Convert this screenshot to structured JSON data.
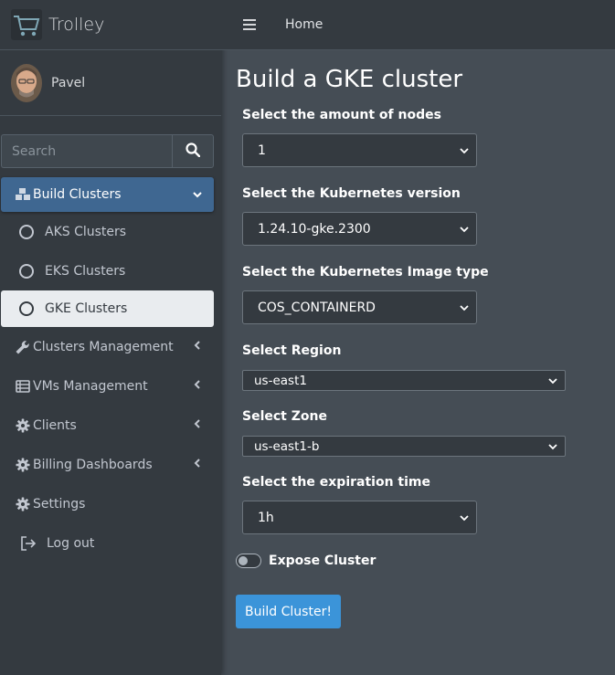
{
  "brand": {
    "name": "Trolley"
  },
  "user": {
    "name": "Pavel"
  },
  "search": {
    "placeholder": "Search"
  },
  "sidebar": {
    "build_clusters": "Build Clusters",
    "sub_items": [
      "AKS Clusters",
      "EKS Clusters",
      "GKE Clusters"
    ],
    "clusters_management": "Clusters Management",
    "vms_management": "VMs Management",
    "clients": "Clients",
    "billing_dashboards": "Billing Dashboards",
    "settings": "Settings",
    "logout": "Log out"
  },
  "topbar": {
    "home": "Home"
  },
  "main": {
    "title": "Build a GKE cluster",
    "fields": [
      {
        "label": "Select the amount of nodes",
        "value": "1"
      },
      {
        "label": "Select the Kubernetes version",
        "value": "1.24.10-gke.2300"
      },
      {
        "label": "Select the Kubernetes Image type",
        "value": "COS_CONTAINERD"
      },
      {
        "label": "Select Region",
        "value": "us-east1"
      },
      {
        "label": "Select Zone",
        "value": "us-east1-b"
      },
      {
        "label": "Select the expiration time",
        "value": "1h"
      }
    ],
    "expose_label": "Expose Cluster",
    "expose_enabled": false,
    "build_button": "Build Cluster!"
  },
  "colors": {
    "sidebar_bg": "#343a40",
    "content_bg": "#454d55",
    "active_nav": "#3f6791",
    "primary_button": "#3b94d9"
  }
}
